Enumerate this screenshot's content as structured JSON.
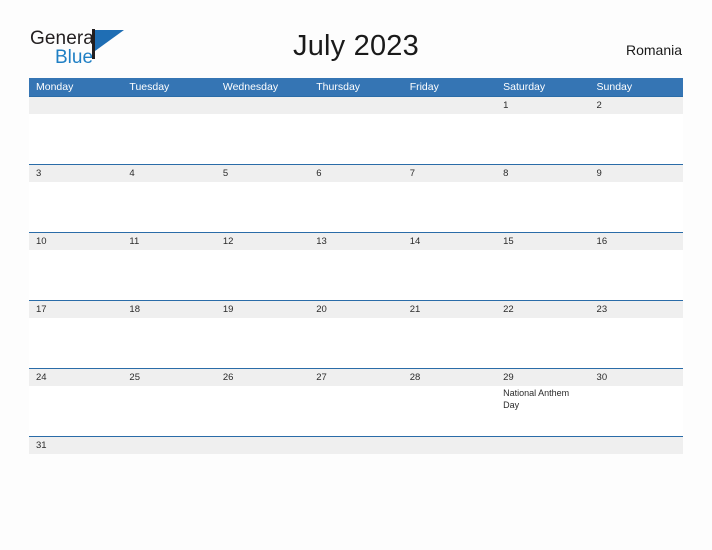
{
  "brand": {
    "name_part1": "General",
    "name_part2": "Blue",
    "mark": "flag-triangle"
  },
  "header": {
    "title": "July 2023",
    "locale": "Romania"
  },
  "colors": {
    "header_blue": "#3575b4",
    "row_border_blue": "#2a6ca8",
    "date_band_gray": "#efefef",
    "brand_blue": "#1f7fc4",
    "text_dark": "#231f20"
  },
  "calendar": {
    "weekdays": [
      "Monday",
      "Tuesday",
      "Wednesday",
      "Thursday",
      "Friday",
      "Saturday",
      "Sunday"
    ],
    "weeks": [
      {
        "days": [
          "",
          "",
          "",
          "",
          "",
          "1",
          "2"
        ],
        "events": [
          "",
          "",
          "",
          "",
          "",
          "",
          ""
        ]
      },
      {
        "days": [
          "3",
          "4",
          "5",
          "6",
          "7",
          "8",
          "9"
        ],
        "events": [
          "",
          "",
          "",
          "",
          "",
          "",
          ""
        ]
      },
      {
        "days": [
          "10",
          "11",
          "12",
          "13",
          "14",
          "15",
          "16"
        ],
        "events": [
          "",
          "",
          "",
          "",
          "",
          "",
          ""
        ]
      },
      {
        "days": [
          "17",
          "18",
          "19",
          "20",
          "21",
          "22",
          "23"
        ],
        "events": [
          "",
          "",
          "",
          "",
          "",
          "",
          ""
        ]
      },
      {
        "days": [
          "24",
          "25",
          "26",
          "27",
          "28",
          "29",
          "30"
        ],
        "events": [
          "",
          "",
          "",
          "",
          "",
          "National Anthem Day",
          ""
        ]
      },
      {
        "days": [
          "31",
          "",
          "",
          "",
          "",
          "",
          ""
        ],
        "events": [
          "",
          "",
          "",
          "",
          "",
          "",
          ""
        ]
      }
    ]
  }
}
